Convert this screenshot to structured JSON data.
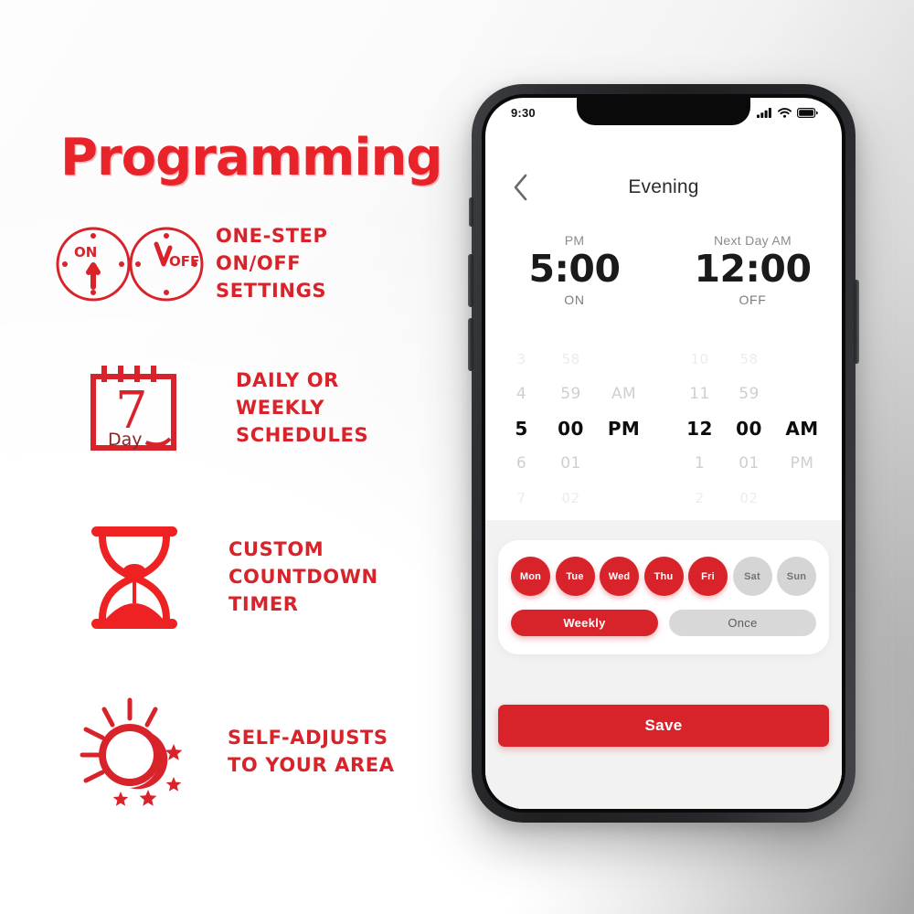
{
  "title": "Programming",
  "brand_color": "#d9232a",
  "features": [
    {
      "icon": "on-off-clocks-icon",
      "text": "ONE-STEP\nON/OFF\nSETTINGS",
      "icon_labels": {
        "on": "ON",
        "off": "OFF"
      }
    },
    {
      "icon": "seven-day-calendar-icon",
      "text": "DAILY OR\nWEEKLY\nSCHEDULES",
      "icon_labels": {
        "number": "7",
        "unit": "Day"
      }
    },
    {
      "icon": "hourglass-icon",
      "text": "CUSTOM\nCOUNTDOWN\nTIMER",
      "icon_labels": {}
    },
    {
      "icon": "sun-stars-icon",
      "text": "SELF-ADJUSTS\nTO YOUR AREA",
      "icon_labels": {}
    }
  ],
  "phone": {
    "status_bar": {
      "time": "9:30",
      "icons": [
        "signal-icon",
        "wifi-icon",
        "battery-icon"
      ]
    },
    "nav": {
      "back_icon": "chevron-left-icon",
      "title": "Evening"
    },
    "time_summary": [
      {
        "meta_top": "PM",
        "value": "5:00",
        "meta_bottom": "ON"
      },
      {
        "meta_top": "Next Day AM",
        "value": "12:00",
        "meta_bottom": "OFF"
      }
    ],
    "pickers": [
      {
        "name": "on-time-picker",
        "hours": [
          "3",
          "4",
          "5",
          "6",
          "7"
        ],
        "minutes": [
          "58",
          "59",
          "00",
          "01",
          "02"
        ],
        "periods": [
          "",
          "AM",
          "PM",
          "",
          ""
        ],
        "selected_index": 2
      },
      {
        "name": "off-time-picker",
        "hours": [
          "10",
          "11",
          "12",
          "1",
          "2"
        ],
        "minutes": [
          "58",
          "59",
          "00",
          "01",
          "02"
        ],
        "periods": [
          "",
          "",
          "AM",
          "PM",
          ""
        ],
        "selected_index": 2
      }
    ],
    "days": [
      {
        "label": "Mon",
        "active": true
      },
      {
        "label": "Tue",
        "active": true
      },
      {
        "label": "Wed",
        "active": true
      },
      {
        "label": "Thu",
        "active": true
      },
      {
        "label": "Fri",
        "active": true
      },
      {
        "label": "Sat",
        "active": false
      },
      {
        "label": "Sun",
        "active": false
      }
    ],
    "repeat_options": [
      {
        "label": "Weekly",
        "active": true
      },
      {
        "label": "Once",
        "active": false
      }
    ],
    "save_label": "Save"
  }
}
